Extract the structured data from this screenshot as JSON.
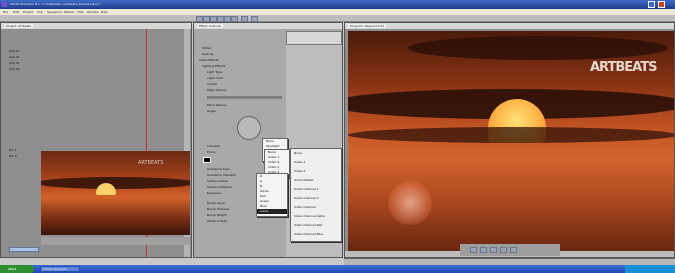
{
  "window": {
    "title": "Adobe Premiere Pro - C:\\Artbeats\\...\\Artbeats_Sunset.prproj *"
  },
  "menu": [
    "File",
    "Edit",
    "Project",
    "Clip",
    "Sequence",
    "Marker",
    "Title",
    "Window",
    "Help"
  ],
  "project_panel": {
    "tab": "Project: Artbeats"
  },
  "project_items": [
    "Clip 01",
    "Clip 02",
    "Clip 03",
    "Clip 04"
  ],
  "source_panel": {
    "tab": "Source"
  },
  "source_bins": [
    "Bin 1",
    "Bin 2"
  ],
  "effect_controls": {
    "tab": "Effect Controls",
    "rows": [
      "Motion",
      "Opacity",
      "Video Effects",
      "Lighting Effects",
      "Light Type",
      "Light Color",
      "Center",
      "Major Radius",
      "Minor Radius",
      "Angle",
      "Intensity",
      "Focus",
      "Ambience Type",
      "Ambience Intensity",
      "Surface Gloss",
      "Surface Material",
      "Exposure",
      "Bump Layer",
      "Bump Channel",
      "Bump Height",
      "White is High"
    ]
  },
  "light_type_menu": [
    "None",
    "Spotlight",
    "Omni",
    "Directional"
  ],
  "track_menu": [
    "None",
    "Video 1",
    "Video 2",
    "Video 3",
    "Video 4"
  ],
  "channel_menu": [
    "R",
    "G",
    "B",
    "Alpha",
    "Red",
    "Green",
    "Blue",
    "Luma"
  ],
  "layer_menu": [
    "None",
    "Video 1",
    "Video 2",
    "Audio Master",
    "Audio Channel 1",
    "Audio Channel 2",
    "Video Channel",
    "Video Channel Alpha",
    "Video Channel Red",
    "Video Channel Blue"
  ],
  "program_monitor": {
    "tab": "Program: Sequence 01",
    "watermark": "ARTBEATS"
  },
  "preview_watermark": "ARTBEATS",
  "taskbar": {
    "start": "start",
    "task1": "Adobe Premiere"
  },
  "colors": {
    "accent_blue": "#1e3c8a",
    "panel_gray": "#a9a9a9",
    "sunset_orange": "#d0632a",
    "start_green": "#2f8f2f"
  }
}
